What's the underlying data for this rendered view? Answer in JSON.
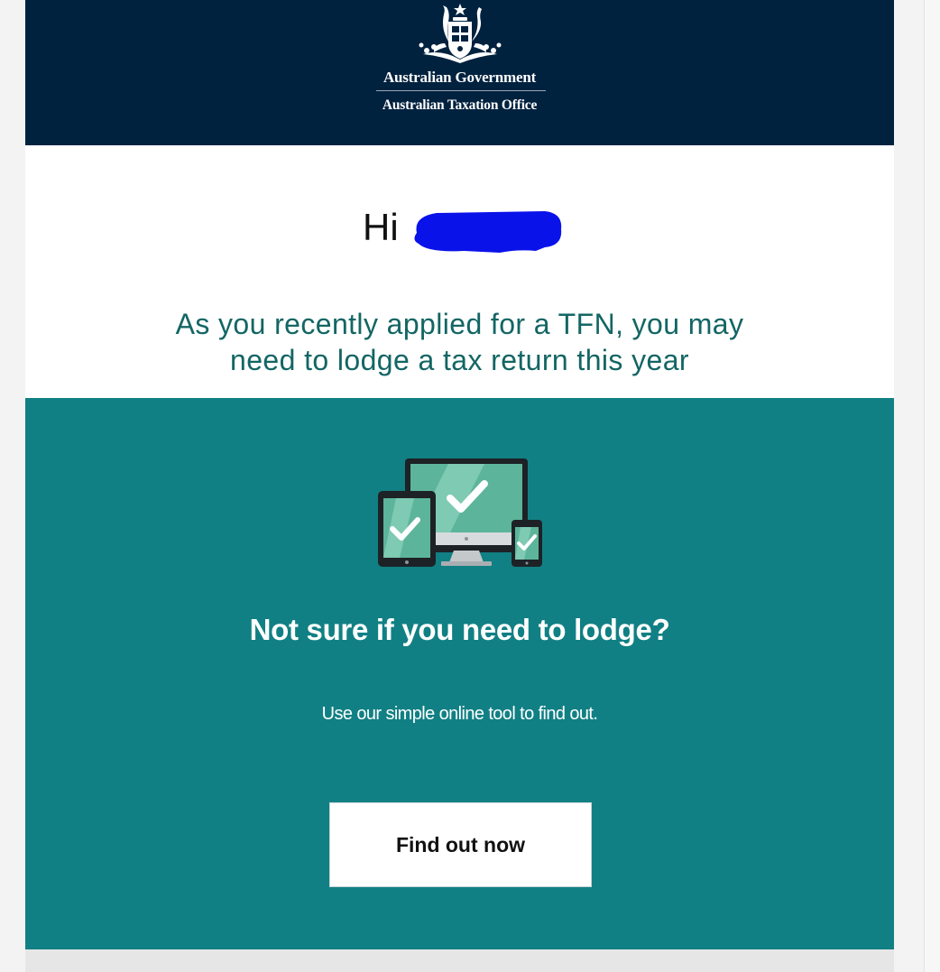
{
  "header": {
    "logo_icon": "commonwealth-coat-of-arms",
    "line1": "Australian Government",
    "line2": "Australian Taxation Office",
    "background_color": "#00223f"
  },
  "greeting": {
    "prefix": "Hi",
    "name_redacted": true
  },
  "intro": {
    "line1": "As you recently applied for a TFN, you may",
    "line2": "need to lodge a tax return this year",
    "color": "#136664"
  },
  "panel": {
    "illustration_icon": "devices-checkmark-icon",
    "title": "Not sure if you need to lodge?",
    "description": "Use our simple online tool to find out.",
    "cta_label": "Find out now",
    "background_color": "#118084"
  }
}
